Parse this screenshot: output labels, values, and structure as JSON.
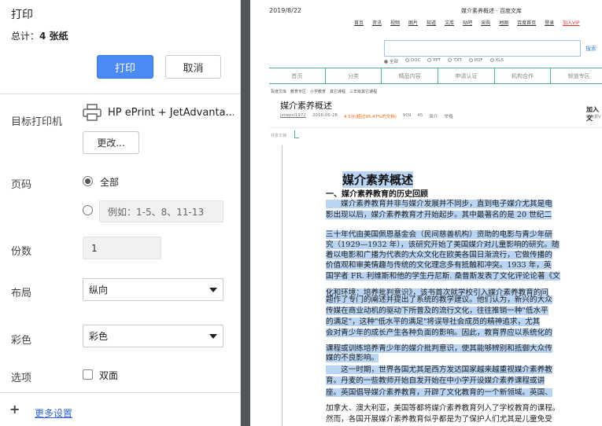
{
  "panel": {
    "title": "打印",
    "total_label": "总计：",
    "total_value": "4 张纸",
    "print_button": "打印",
    "cancel_button": "取消",
    "destination": {
      "label": "目标打印机",
      "printer_name": "HP ePrint + JetAdvanta...",
      "change_button": "更改..."
    },
    "pages": {
      "label": "页码",
      "option_all": "全部",
      "custom_placeholder": "例如：1-5、8、11-13"
    },
    "copies": {
      "label": "份数",
      "value": "1"
    },
    "layout": {
      "label": "布局",
      "selected": "纵向"
    },
    "color": {
      "label": "彩色",
      "selected": "彩色"
    },
    "options": {
      "label": "选项",
      "two_sided": "双面"
    },
    "more_settings": "更多设置"
  },
  "preview": {
    "header_date": "2019/8/22",
    "header_title": "媒介素养概述 - 百度文库",
    "top_nav": [
      "首页",
      "资讯",
      "视频",
      "图片",
      "知道",
      "文库",
      "贴吧",
      "采购",
      "地图",
      "百度首页",
      "登录",
      "加入VIP"
    ],
    "search_button": "搜索",
    "search_filters": [
      "全部",
      "DOC",
      "PPT",
      "TXT",
      "PDF",
      "XLS"
    ],
    "category_nav": [
      "首页",
      "分类",
      "精品内容",
      "申请认证",
      "机构合作",
      "频道专区"
    ],
    "breadcrumbs": [
      "百度文库",
      "教育专区",
      "小学教育",
      "其它课程",
      "三年级其它课程"
    ],
    "doc_title": "媒介素养概述",
    "doc_meta": {
      "author": "jstwpsl1972",
      "date": "2018-06-28",
      "score": "4.5分(超过95.47%的文档)",
      "views": "909",
      "downloads": "45",
      "report": "简介",
      "extra": "举报"
    },
    "join_title": "加入文",
    "join_sub": "送免费V",
    "share_label": "共享文档",
    "article": {
      "h1": "媒介素养概述",
      "h2": "一、媒介素养教育的历史回顾",
      "lines": [
        "　　媒介素养教育并非与媒介发展并不同步，直到电子媒介尤其是电",
        "影出现以后，媒介素养教育才开始起步。其中最著名的是 20 世纪二",
        "",
        "三十年代由美国佩恩基金会（民间慈善机构）资助的电影与青少年研",
        "究（1929—1932 年），该研究开始了美国媒介对儿童影响的研究。随",
        "着以电影和广播为代表的大众文化在欧美各国日渐流行，它做传播的",
        "价值观和审美情趣与传统的文化理念多有抵触和冲突。1933 年，英",
        "国学者 FR. 利维斯和他的学生丹尼斯. 桑普斯发表了文化评论论著《文",
        "化和环境：培养批判意识》，该书首次就学校引入媒介素养教育的问",
        "题作了专门的阐述并提出了系统的教学建议。他们认为，新兴的大众",
        "传媒在商业动机的驱动下所普及的流行文化，往往推销一种\"低水平",
        "的满足\"，这种\"低水平的满足\"将误导社会成员的精神追求，尤其",
        "会对青少年的成长产生各种负面的影响。因此，教育界应以系统化的",
        "课程或训练培养青少年的媒介批判意识，使其能够辨别和抵御大众传",
        "媒的不良影响。",
        "　　这一时期，世界各国尤其是西方发达国家越来越重视媒介素养教",
        "育。丹麦的一些教师开始自发开始在中小学开设媒介素养课程或讲",
        "座。英国倡导媒介素养教育，开辟了文化教育的一个新领域。英国、",
        "加拿大、澳大利亚，美国等都将媒介素养教育列入了学校教育的课程。",
        "然而，各国开展媒介素养教育似乎都是为了保护人们尤其是儿童免受"
      ]
    }
  }
}
